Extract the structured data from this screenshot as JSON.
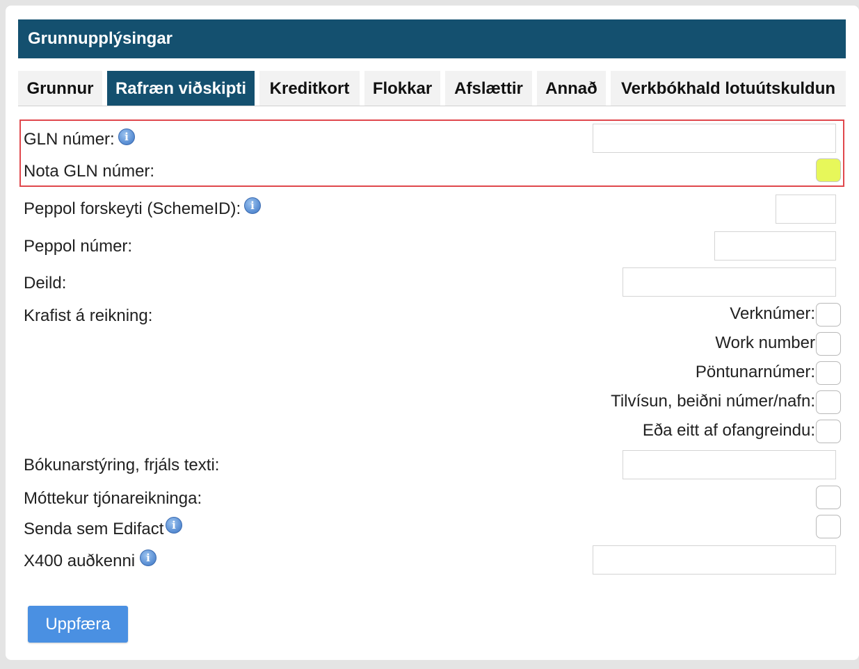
{
  "header": {
    "title": "Grunnupplýsingar"
  },
  "tabs": [
    {
      "label": "Grunnur"
    },
    {
      "label": "Rafræn viðskipti"
    },
    {
      "label": "Kreditkort"
    },
    {
      "label": "Flokkar"
    },
    {
      "label": "Afslættir"
    },
    {
      "label": "Annað"
    },
    {
      "label": "Verkbókhald lotuútskuldun"
    }
  ],
  "active_tab": "Rafræn viðskipti",
  "fields": {
    "gln_number": {
      "label": "GLN númer:",
      "value": ""
    },
    "use_gln": {
      "label": "Nota GLN númer:",
      "checked": true
    },
    "peppol_prefix": {
      "label": "Peppol forskeyti (SchemeID):",
      "value": ""
    },
    "peppol_number": {
      "label": "Peppol númer:",
      "value": ""
    },
    "department": {
      "label": "Deild:",
      "value": ""
    },
    "required_on_invoice": {
      "label": "Krafist á reikning:",
      "options": [
        {
          "label": "Verknúmer:",
          "checked": false
        },
        {
          "label": "Work number",
          "checked": false
        },
        {
          "label": "Pöntunarnúmer:",
          "checked": false
        },
        {
          "label": "Tilvísun, beiðni númer/nafn:",
          "checked": false
        },
        {
          "label": "Eða eitt af ofangreindu:",
          "checked": false
        }
      ]
    },
    "booking_control": {
      "label": "Bókunarstýring, frjáls texti:",
      "value": ""
    },
    "receives_damage_invoices": {
      "label": "Móttekur tjónareikninga:",
      "checked": false
    },
    "send_edifact": {
      "label": "Senda sem Edifact",
      "checked": false
    },
    "x400_id": {
      "label": "X400 auðkenni",
      "value": ""
    }
  },
  "buttons": {
    "update": "Uppfæra"
  },
  "icons": {
    "info": "info-icon",
    "info_glyph": "i"
  },
  "colors": {
    "header_bg": "#14506f",
    "active_tab_bg": "#14506f",
    "highlight_border": "#e0474c",
    "checked_fill": "#e7f75a",
    "button_bg": "#4a90e2"
  }
}
